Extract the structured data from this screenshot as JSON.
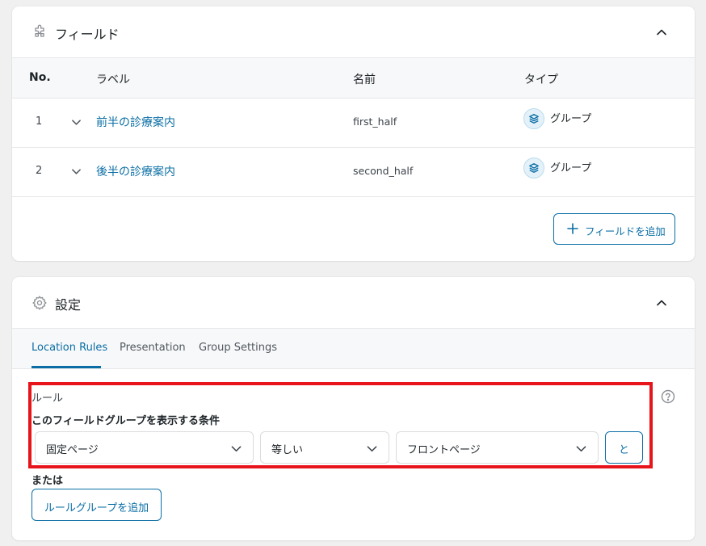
{
  "fields_panel": {
    "title": "フィールド",
    "columns": {
      "no": "No.",
      "label": "ラベル",
      "name": "名前",
      "type": "タイプ"
    },
    "rows": [
      {
        "no": "1",
        "label": "前半の診療案内",
        "name": "first_half",
        "type": "グループ"
      },
      {
        "no": "2",
        "label": "後半の診療案内",
        "name": "second_half",
        "type": "グループ"
      }
    ],
    "add_field_label": "フィールドを追加"
  },
  "settings_panel": {
    "title": "設定",
    "tabs": [
      {
        "label": "Location Rules",
        "active": true
      },
      {
        "label": "Presentation",
        "active": false
      },
      {
        "label": "Group Settings",
        "active": false
      }
    ],
    "rules_title": "ルール",
    "rules_subtitle": "このフィールドグループを表示する条件",
    "rule": {
      "param": "固定ページ",
      "operator": "等しい",
      "value": "フロントページ"
    },
    "and_label": "と",
    "or_label": "または",
    "add_group_label": "ルールグループを追加"
  },
  "colors": {
    "accent": "#0a6ea5",
    "highlight": "#e8141c",
    "background": "#f0f0f1"
  },
  "icons": {
    "fields": "puzzle-icon",
    "settings": "gear-icon",
    "collapse": "chevron-up-icon",
    "row_expand": "chevron-down-icon",
    "type": "layers-icon",
    "add": "plus-icon",
    "help": "question-circle-icon",
    "select": "chevron-down-icon"
  }
}
